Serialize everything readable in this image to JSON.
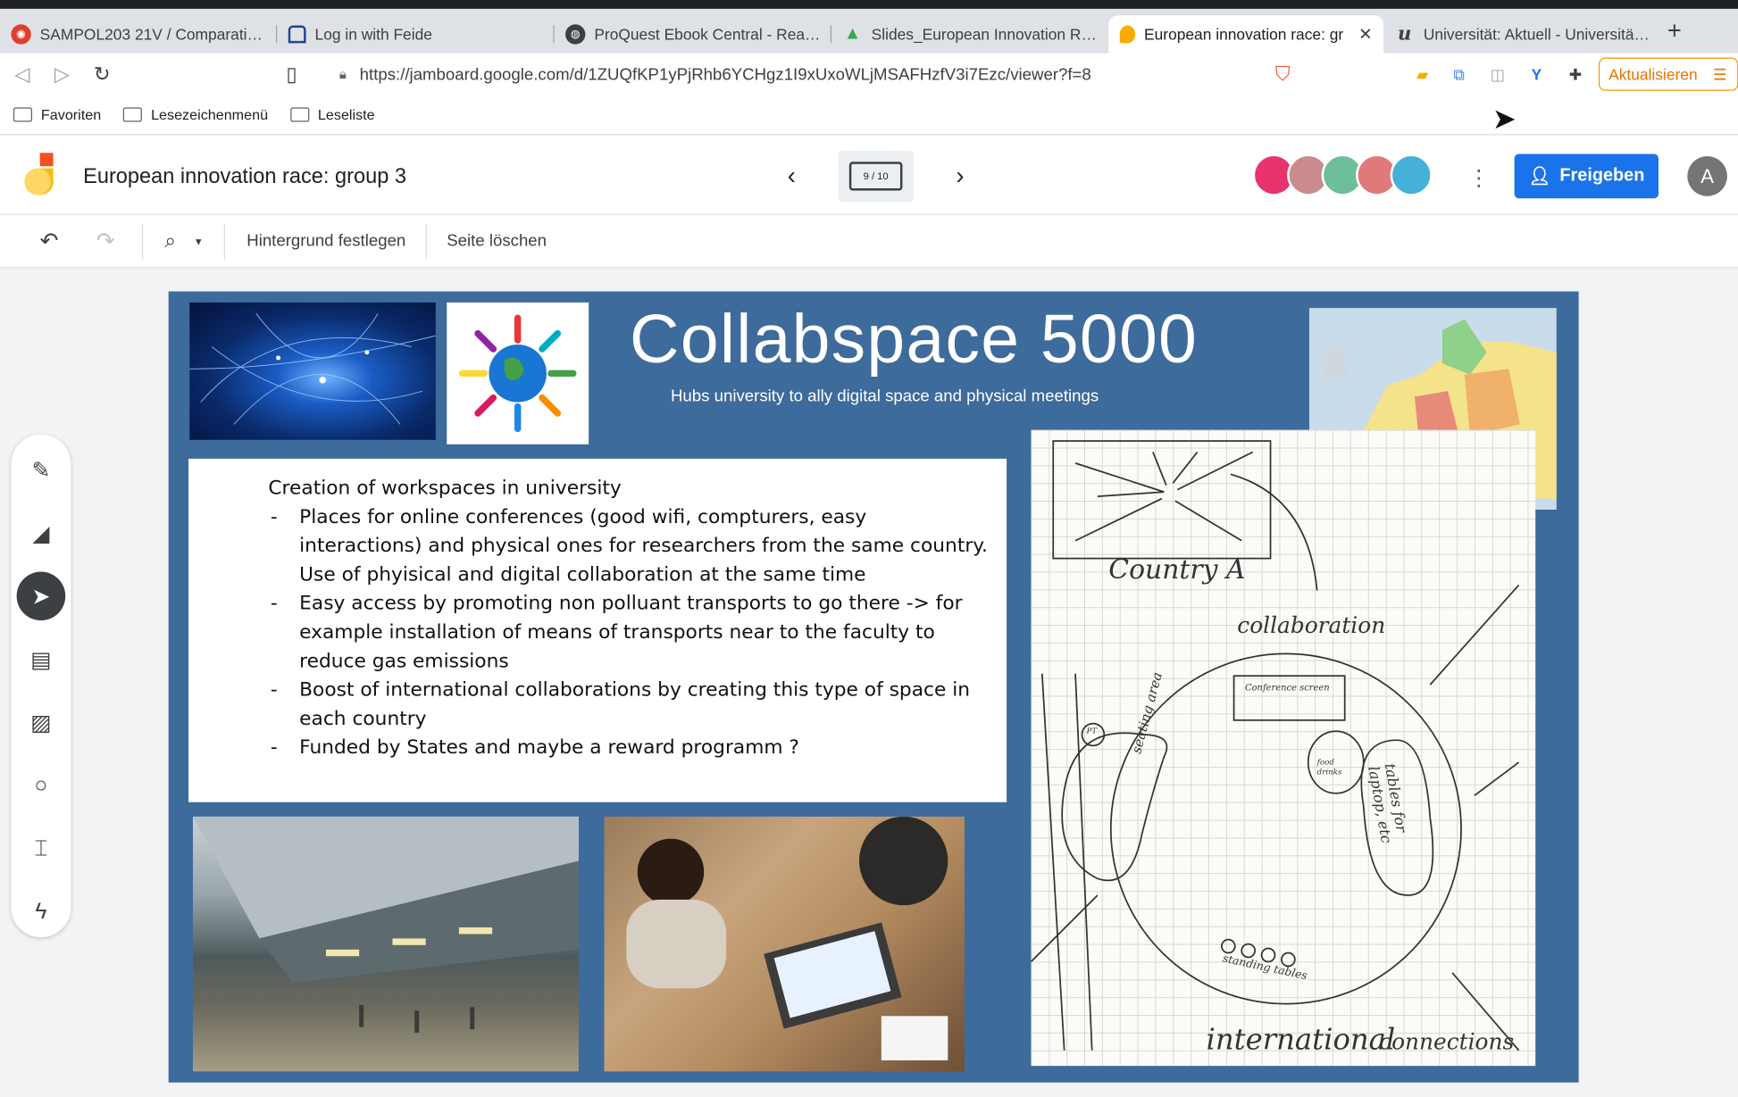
{
  "browser": {
    "tabs": [
      {
        "title": "SAMPOL203 21V / Comparative A",
        "active": false,
        "icon": "canvas-icon",
        "color": "#e03e2d"
      },
      {
        "title": "Log in with Feide",
        "active": false,
        "icon": "feide-icon",
        "color": "#1f4698"
      },
      {
        "title": "ProQuest Ebook Central - Reader",
        "active": false,
        "icon": "globe-icon",
        "color": "#3c4043"
      },
      {
        "title": "Slides_European Innovation Race",
        "active": false,
        "icon": "google-drive-icon",
        "color": "#34a853"
      },
      {
        "title": "European innovation race: gr",
        "active": true,
        "icon": "jamboard-icon",
        "color": "#f9ab00"
      },
      {
        "title": "Universität: Aktuell - Universität E",
        "active": false,
        "icon": "uni-icon",
        "color": "#202124"
      }
    ],
    "url": "https://jamboard.google.com/d/1ZUQfKP1yPjRhb6YCHgz1I9xUxoWLjMSAFHzfV3i7Ezc/viewer?f=8",
    "update_label": "Aktualisieren",
    "extension_badge": "2",
    "shield_badge": "1",
    "bookmarks": [
      "Favoriten",
      "Lesezeichenmenü",
      "Leseliste"
    ]
  },
  "jamboard": {
    "title": "European innovation race: group 3",
    "page_indicator": "9 / 10",
    "share_label": "Freigeben",
    "account_initial": "A",
    "set_background_label": "Hintergrund festlegen",
    "delete_page_label": "Seite löschen",
    "avatar_colors": [
      "#e8336d",
      "#c98b8b",
      "#6dbf9a",
      "#e07a7a",
      "#45b1d8"
    ]
  },
  "slide": {
    "title": "Collabspace 5000",
    "subtitle": "Hubs  university to ally digital space and physical meetings",
    "heading": "Creation of workspaces in university",
    "bullets": [
      "Places for online conferences (good wifi, compturers, easy interactions) and physical ones for researchers from the same country. Use of phyisical and digital collaboration at the same time",
      "Easy access by promoting non polluant transports to go there -> for example installation of means of transports near to the faculty to reduce gas emissions",
      "Boost of international collaborations by creating this type of space in each country",
      "Funded by States and maybe a reward programm ?"
    ],
    "background_color": "#3d6b9b",
    "sketch": {
      "country": "Country A",
      "collaboration": "collaboration",
      "conference": "Conference screen",
      "food": "food drinks",
      "seating": "seating area",
      "tables": "tables for laptop, etc",
      "standing": "standing tables",
      "international": "international",
      "connections": "connections",
      "pt": "PT"
    }
  }
}
